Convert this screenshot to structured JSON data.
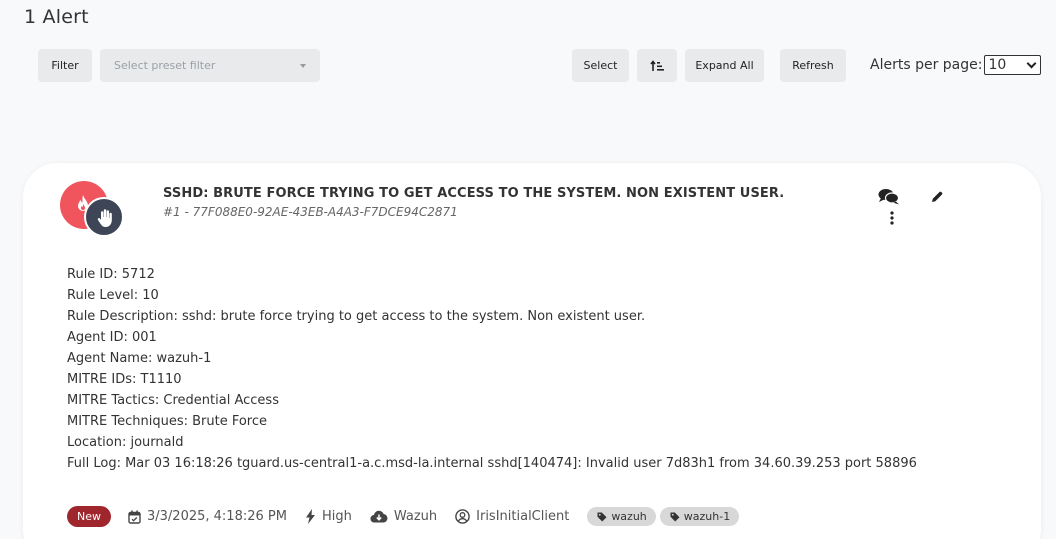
{
  "header": {
    "title": "1 Alert"
  },
  "toolbar": {
    "filter_label": "Filter",
    "preset_placeholder": "Select preset filter",
    "select_label": "Select",
    "sort_icon": "sort-icon",
    "expand_label": "Expand All",
    "refresh_label": "Refresh",
    "per_page_label": "Alerts per page:",
    "per_page_value": "10"
  },
  "alert": {
    "title": "SSHD: BRUTE FORCE TRYING TO GET ACCESS TO THE SYSTEM. NON EXISTENT USER.",
    "subtitle": "#1 - 77F088E0-92AE-43EB-A4A3-F7DCE94C2871",
    "colors": {
      "severity": "#f0545c",
      "status": "#3e4556",
      "new_badge": "#a0262e"
    },
    "details": [
      "Rule ID: 5712",
      "Rule Level: 10",
      "Rule Description: sshd: brute force trying to get access to the system. Non existent user.",
      "Agent ID: 001",
      "Agent Name: wazuh-1",
      "MITRE IDs: T1110",
      "MITRE Tactics: Credential Access",
      "MITRE Techniques: Brute Force",
      "Location: journald",
      "Full Log: Mar 03 16:18:26 tguard.us-central1-a.c.msd-la.internal sshd[140474]: Invalid user 7d83h1 from 34.60.39.253 port 58896"
    ],
    "status_badge": "New",
    "date": "3/3/2025, 4:18:26 PM",
    "severity": "High",
    "source": "Wazuh",
    "client": "IrisInitialClient",
    "tags": [
      "wazuh",
      "wazuh-1"
    ]
  }
}
